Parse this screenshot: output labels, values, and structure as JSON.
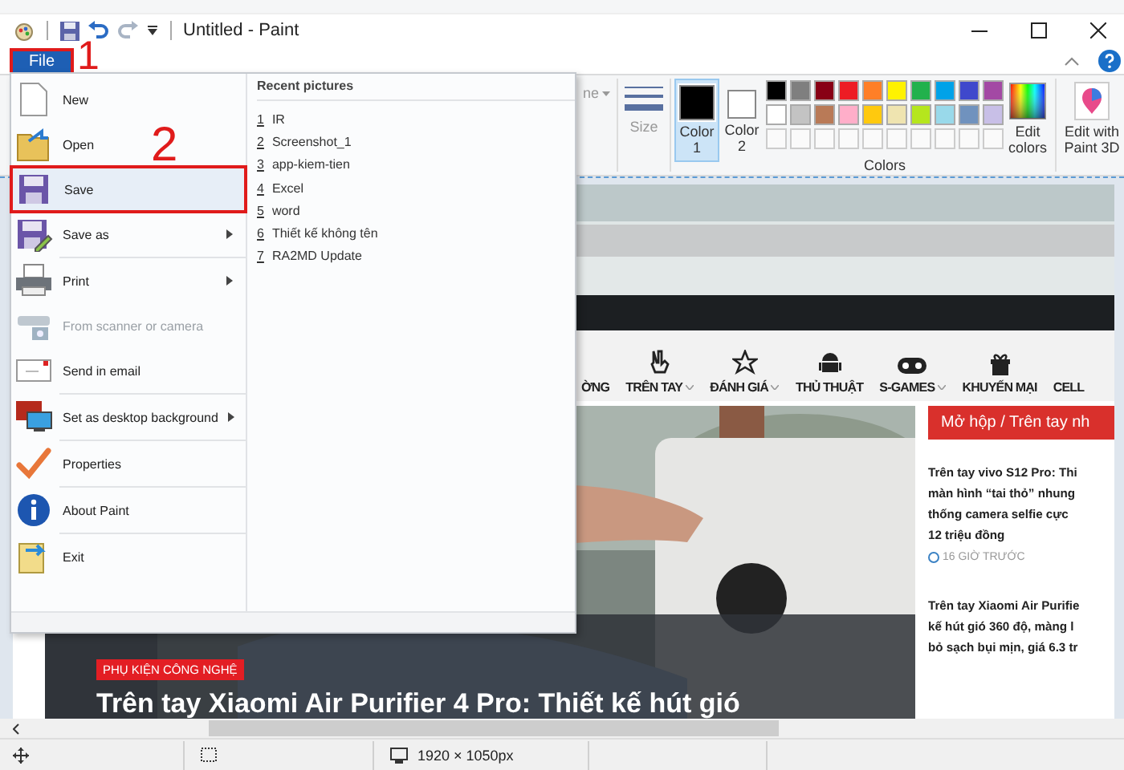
{
  "title_bar": {
    "title": "Untitled - Paint"
  },
  "file_tab": {
    "label": "File",
    "selected": true,
    "annotated": true
  },
  "annotations": [
    {
      "label": "1",
      "kind": "file"
    },
    {
      "label": "2",
      "kind": "save"
    }
  ],
  "file_menu": {
    "items": [
      {
        "label": "New",
        "kind": "new",
        "submenu": false,
        "disabled": false,
        "selected": false,
        "annotated": false,
        "separator_before": false
      },
      {
        "label": "Open",
        "kind": "open",
        "submenu": false,
        "disabled": false,
        "selected": false,
        "annotated": false,
        "separator_before": false
      },
      {
        "label": "Save",
        "kind": "save",
        "submenu": false,
        "disabled": false,
        "selected": true,
        "annotated": true,
        "separator_before": false
      },
      {
        "label": "Save as",
        "kind": "saveas",
        "submenu": true,
        "disabled": false,
        "selected": false,
        "annotated": false,
        "separator_before": false
      },
      {
        "label": "Print",
        "kind": "print",
        "submenu": true,
        "disabled": false,
        "selected": false,
        "annotated": false,
        "separator_before": true
      },
      {
        "label": "From scanner or camera",
        "kind": "scanner",
        "submenu": false,
        "disabled": true,
        "selected": false,
        "annotated": false,
        "separator_before": false
      },
      {
        "label": "Send in email",
        "kind": "email",
        "submenu": false,
        "disabled": false,
        "selected": false,
        "annotated": false,
        "separator_before": false
      },
      {
        "label": "Set as desktop background",
        "kind": "desktop",
        "submenu": true,
        "disabled": false,
        "selected": false,
        "annotated": false,
        "separator_before": true
      },
      {
        "label": "Properties",
        "kind": "properties",
        "submenu": false,
        "disabled": false,
        "selected": false,
        "annotated": false,
        "separator_before": true
      },
      {
        "label": "About Paint",
        "kind": "about",
        "submenu": false,
        "disabled": false,
        "selected": false,
        "annotated": false,
        "separator_before": true
      },
      {
        "label": "Exit",
        "kind": "exit",
        "submenu": false,
        "disabled": false,
        "selected": false,
        "annotated": false,
        "separator_before": true
      }
    ],
    "recent_heading": "Recent pictures",
    "recent": [
      {
        "number": "1",
        "name": "IR"
      },
      {
        "number": "2",
        "name": "Screenshot_1"
      },
      {
        "number": "3",
        "name": "app-kiem-tien"
      },
      {
        "number": "4",
        "name": "Excel"
      },
      {
        "number": "5",
        "name": "word"
      },
      {
        "number": "6",
        "name": "Thiết kế không tên"
      },
      {
        "number": "7",
        "name": "RA2MD Update"
      }
    ]
  },
  "ribbon": {
    "cut_label": "ne",
    "size_label": "Size",
    "color_slots": [
      {
        "label": "Color",
        "number": "1",
        "color": "#000000",
        "selected": true
      },
      {
        "label": "Color",
        "number": "2",
        "color": "#ffffff",
        "selected": false
      }
    ],
    "palette": [
      {
        "color": "#000000"
      },
      {
        "color": "#7f7f7f"
      },
      {
        "color": "#880015"
      },
      {
        "color": "#ed1c24"
      },
      {
        "color": "#ff7f27"
      },
      {
        "color": "#fff200"
      },
      {
        "color": "#22b14c"
      },
      {
        "color": "#00a2e8"
      },
      {
        "color": "#3f48cc"
      },
      {
        "color": "#a349a4"
      },
      {
        "color": "#ffffff"
      },
      {
        "color": "#c3c3c3"
      },
      {
        "color": "#b97a57"
      },
      {
        "color": "#ffaec9"
      },
      {
        "color": "#ffc90e"
      },
      {
        "color": "#efe4b0"
      },
      {
        "color": "#b5e61d"
      },
      {
        "color": "#99d9ea"
      },
      {
        "color": "#7092be"
      },
      {
        "color": "#c8bfe7"
      }
    ],
    "edit_colors": "Edit colors",
    "paint3d": "Edit with Paint 3D",
    "group_label": "Colors"
  },
  "web_page": {
    "nav": [
      {
        "label": "ỜNG",
        "kind": "none",
        "dropdown": false
      },
      {
        "label": "TRÊN TAY",
        "kind": "hand",
        "dropdown": true
      },
      {
        "label": "ĐÁNH GIÁ",
        "kind": "star",
        "dropdown": true
      },
      {
        "label": "THỦ THUẬT",
        "kind": "android",
        "dropdown": false
      },
      {
        "label": "S-GAMES",
        "kind": "gamepad",
        "dropdown": true
      },
      {
        "label": "KHUYẾN MẠI",
        "kind": "gift",
        "dropdown": false
      },
      {
        "label": "CELL",
        "kind": "none",
        "dropdown": false
      }
    ],
    "featured": {
      "tag": "PHỤ KIỆN CÔNG NGHỆ",
      "headline": "Trên tay Xiaomi Air Purifier 4 Pro: Thiết kế hút gió"
    },
    "section_title": "Mở hộp / Trên tay nh",
    "articles": [
      {
        "lines": [
          "Trên tay vivo S12 Pro: Thi",
          "màn hình “tai thỏ” nhung",
          "thống camera selfie cực",
          "12 triệu đồng"
        ],
        "time": "16 GIỜ TRƯỚC"
      },
      {
        "lines": [
          "Trên tay Xiaomi Air Purifie",
          "kế hút gió 360 độ, màng l",
          "bỏ sạch bụi mịn, giá 6.3 tr"
        ]
      }
    ]
  },
  "status_bar": {
    "image_size": "1920 × 1050px"
  }
}
